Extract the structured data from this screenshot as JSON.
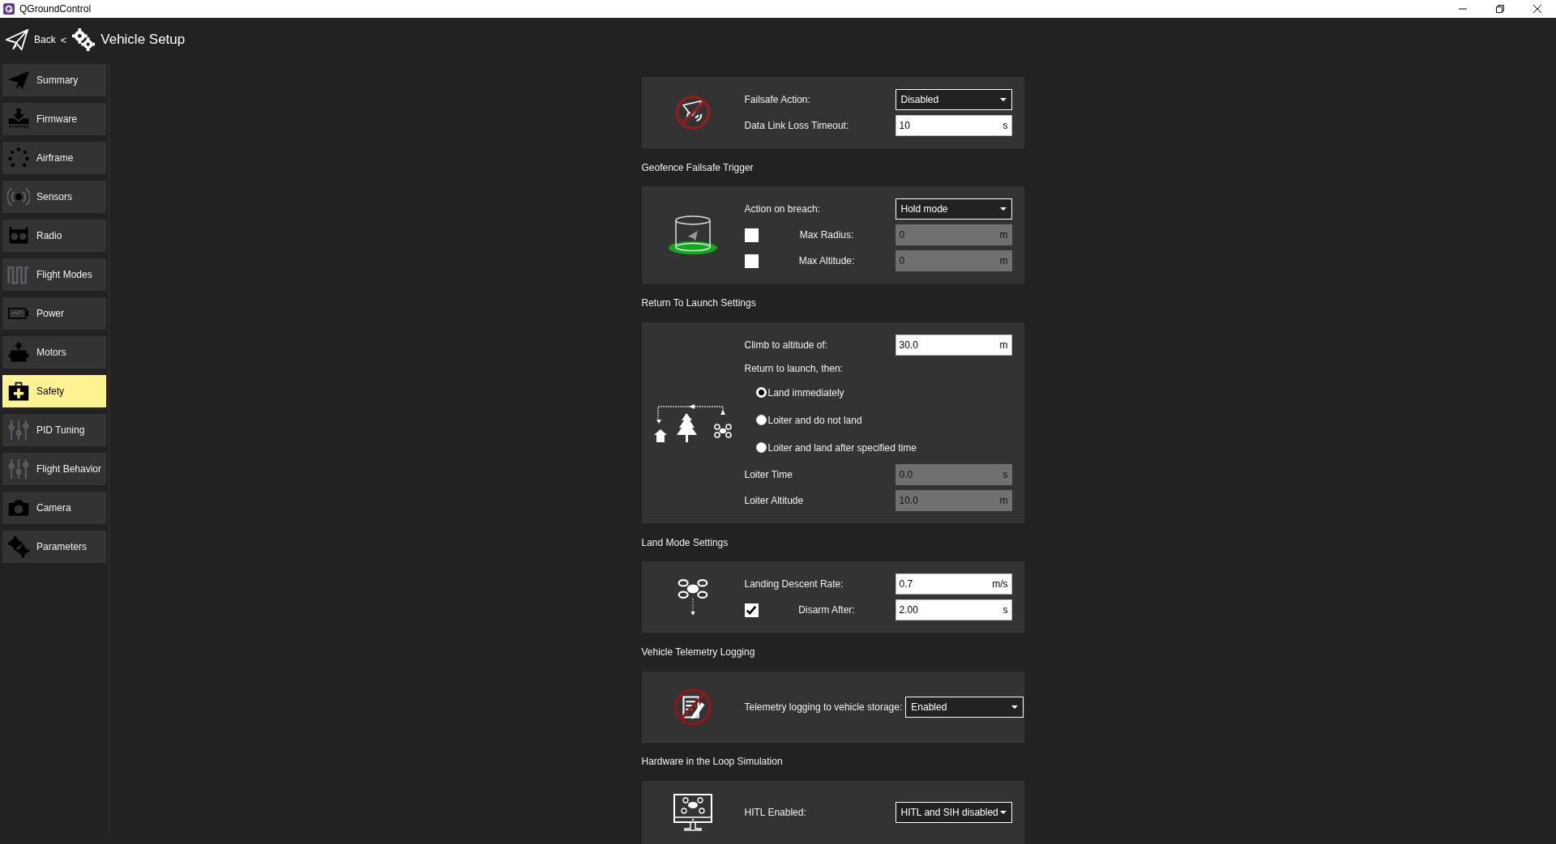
{
  "window": {
    "title": "QGroundControl"
  },
  "header": {
    "back": "Back",
    "separator": "<",
    "title": "Vehicle Setup"
  },
  "sidebar": {
    "items": [
      {
        "label": "Summary",
        "selected": false
      },
      {
        "label": "Firmware",
        "selected": false
      },
      {
        "label": "Airframe",
        "selected": false
      },
      {
        "label": "Sensors",
        "selected": false
      },
      {
        "label": "Radio",
        "selected": false
      },
      {
        "label": "Flight Modes",
        "selected": false
      },
      {
        "label": "Power",
        "selected": false
      },
      {
        "label": "Motors",
        "selected": false
      },
      {
        "label": "Safety",
        "selected": true
      },
      {
        "label": "PID Tuning",
        "selected": false
      },
      {
        "label": "Flight Behavior",
        "selected": false
      },
      {
        "label": "Camera",
        "selected": false
      },
      {
        "label": "Parameters",
        "selected": false
      }
    ]
  },
  "sections": [
    {
      "rows": [
        {
          "kind": "combo",
          "label": "Failsafe Action:",
          "value": "Disabled"
        },
        {
          "kind": "field",
          "label": "Data Link Loss Timeout:",
          "value": "10",
          "unit": "s",
          "disabled": false
        }
      ]
    },
    {
      "title": "Geofence Failsafe Trigger",
      "rows": [
        {
          "kind": "combo",
          "label": "Action on breach:",
          "value": "Hold mode"
        },
        {
          "kind": "check_field",
          "checked": false,
          "label": "Max Radius:",
          "value": "0",
          "unit": "m",
          "disabled": true
        },
        {
          "kind": "check_field",
          "checked": false,
          "label": "Max Altitude:",
          "value": "0",
          "unit": "m",
          "disabled": true
        }
      ]
    },
    {
      "title": "Return To Launch Settings",
      "rows": [
        {
          "kind": "field",
          "label": "Climb to altitude of:",
          "value": "30.0",
          "unit": "m",
          "disabled": false
        },
        {
          "kind": "text",
          "label": "Return to launch, then:"
        },
        {
          "kind": "radio",
          "label": "Land immediately",
          "selected": true
        },
        {
          "kind": "radio",
          "label": "Loiter and do not land",
          "selected": false
        },
        {
          "kind": "radio",
          "label": "Loiter and land after specified time",
          "selected": false
        },
        {
          "kind": "field",
          "label": "Loiter Time",
          "value": "0.0",
          "unit": "s",
          "disabled": true
        },
        {
          "kind": "field",
          "label": "Loiter Altitude",
          "value": "10.0",
          "unit": "m",
          "disabled": true
        }
      ]
    },
    {
      "title": "Land Mode Settings",
      "rows": [
        {
          "kind": "field",
          "label": "Landing Descent Rate:",
          "value": "0.7",
          "unit": "m/s",
          "disabled": false
        },
        {
          "kind": "check_field",
          "checked": true,
          "label": "Disarm After:",
          "value": "2.00",
          "unit": "s",
          "disabled": false
        }
      ]
    },
    {
      "title": "Vehicle Telemetry Logging",
      "rows": [
        {
          "kind": "inline_combo",
          "label": "Telemetry logging to vehicle storage:",
          "value": "Enabled"
        }
      ]
    },
    {
      "title": "Hardware in the Loop Simulation",
      "rows": [
        {
          "kind": "combo",
          "label": "HITL Enabled:",
          "value": "HITL and SIH disabled"
        }
      ]
    }
  ]
}
